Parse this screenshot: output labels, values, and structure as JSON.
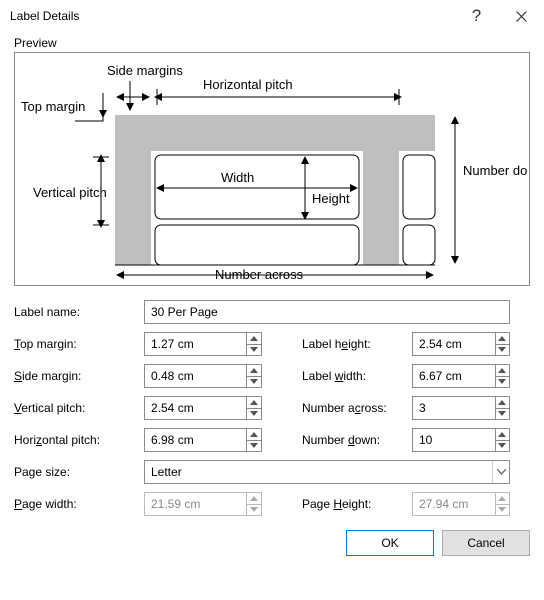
{
  "window": {
    "title": "Label Details"
  },
  "preview": {
    "label": "Preview",
    "texts": {
      "top_margin": "Top margin",
      "side_margins": "Side margins",
      "horizontal_pitch": "Horizontal pitch",
      "vertical_pitch": "Vertical pitch",
      "width": "Width",
      "height": "Height",
      "number_down": "Number down",
      "number_across": "Number across"
    }
  },
  "form": {
    "label_name": {
      "label": "Label name:",
      "value": "30 Per Page"
    },
    "top_margin": {
      "label_pre": "",
      "u": "T",
      "label_post": "op margin:",
      "value": "1.27 cm"
    },
    "side_margin": {
      "label_pre": "",
      "u": "S",
      "label_post": "ide margin:",
      "value": "0.48 cm"
    },
    "vertical_pitch": {
      "label_pre": "",
      "u": "V",
      "label_post": "ertical pitch:",
      "value": "2.54 cm"
    },
    "horizontal_pitch": {
      "label_pre": "Hori",
      "u": "z",
      "label_post": "ontal pitch:",
      "value": "6.98 cm"
    },
    "label_height": {
      "label_pre": "Label h",
      "u": "e",
      "label_post": "ight:",
      "value": "2.54 cm"
    },
    "label_width": {
      "label_pre": "Label ",
      "u": "w",
      "label_post": "idth:",
      "value": "6.67 cm"
    },
    "number_across": {
      "label_pre": "Number a",
      "u": "c",
      "label_post": "ross:",
      "value": "3"
    },
    "number_down": {
      "label_pre": "Number ",
      "u": "d",
      "label_post": "own:",
      "value": "10"
    },
    "page_size": {
      "label": "Page size:",
      "value": "Letter"
    },
    "page_width": {
      "label_pre": "",
      "u": "P",
      "label_post": "age width:",
      "value": "21.59 cm"
    },
    "page_height": {
      "label_pre": "Page ",
      "u": "H",
      "label_post": "eight:",
      "value": "27.94 cm"
    }
  },
  "buttons": {
    "ok": "OK",
    "cancel": "Cancel"
  }
}
